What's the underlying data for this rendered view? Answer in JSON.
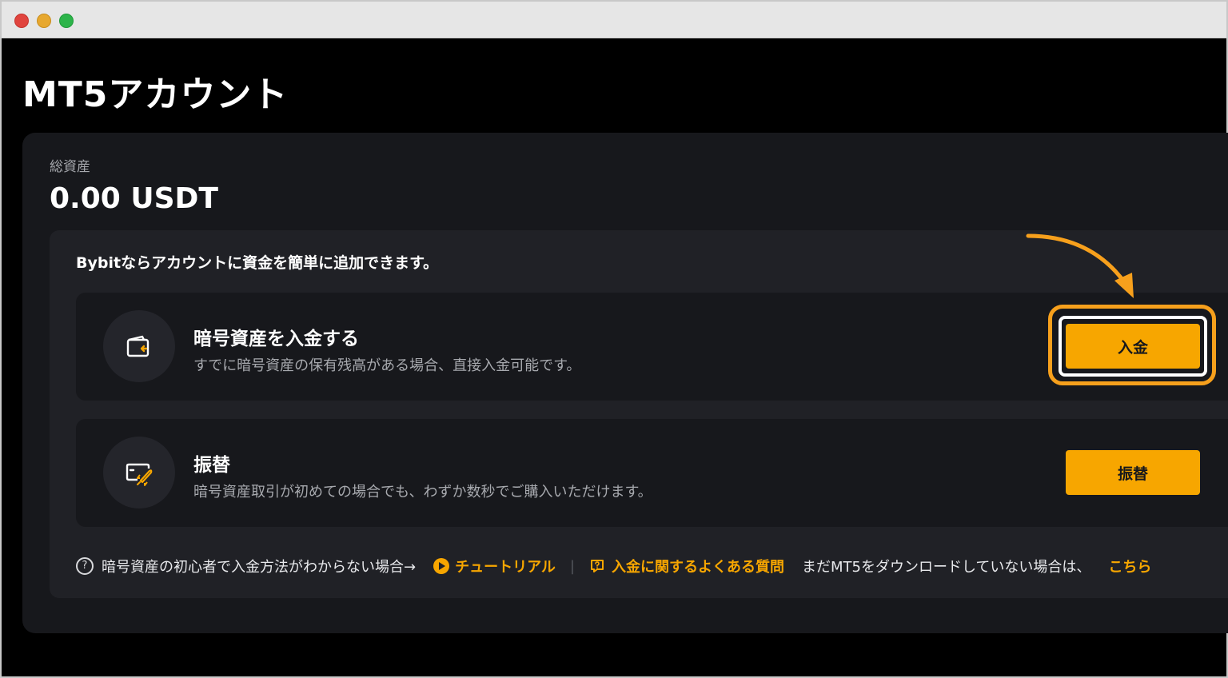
{
  "page": {
    "title": "MT5アカウント"
  },
  "assets": {
    "label": "総資産",
    "value": "0.00 USDT"
  },
  "funding": {
    "intro": "Bybitならアカウントに資金を簡単に追加できます。",
    "options": [
      {
        "icon": "wallet-deposit-icon",
        "title": "暗号資産を入金する",
        "description": "すでに暗号資産の保有残高がある場合、直接入金可能です。",
        "button_label": "入金"
      },
      {
        "icon": "rocket-transfer-icon",
        "title": "振替",
        "description": "暗号資産取引が初めての場合でも、わずか数秒でご購入いただけます。",
        "button_label": "振替"
      }
    ]
  },
  "footer": {
    "help_text": "暗号資産の初心者で入金方法がわからない場合→",
    "tutorial_link": "チュートリアル",
    "separator": "|",
    "faq_link": "入金に関するよくある質問",
    "download_text": "まだMT5をダウンロードしていない場合は、",
    "download_link": "こちら"
  },
  "colors": {
    "accent": "#f7a600",
    "background": "#000000",
    "card": "#17181c",
    "inner_card": "#202126",
    "highlight": "#f7a01c"
  }
}
